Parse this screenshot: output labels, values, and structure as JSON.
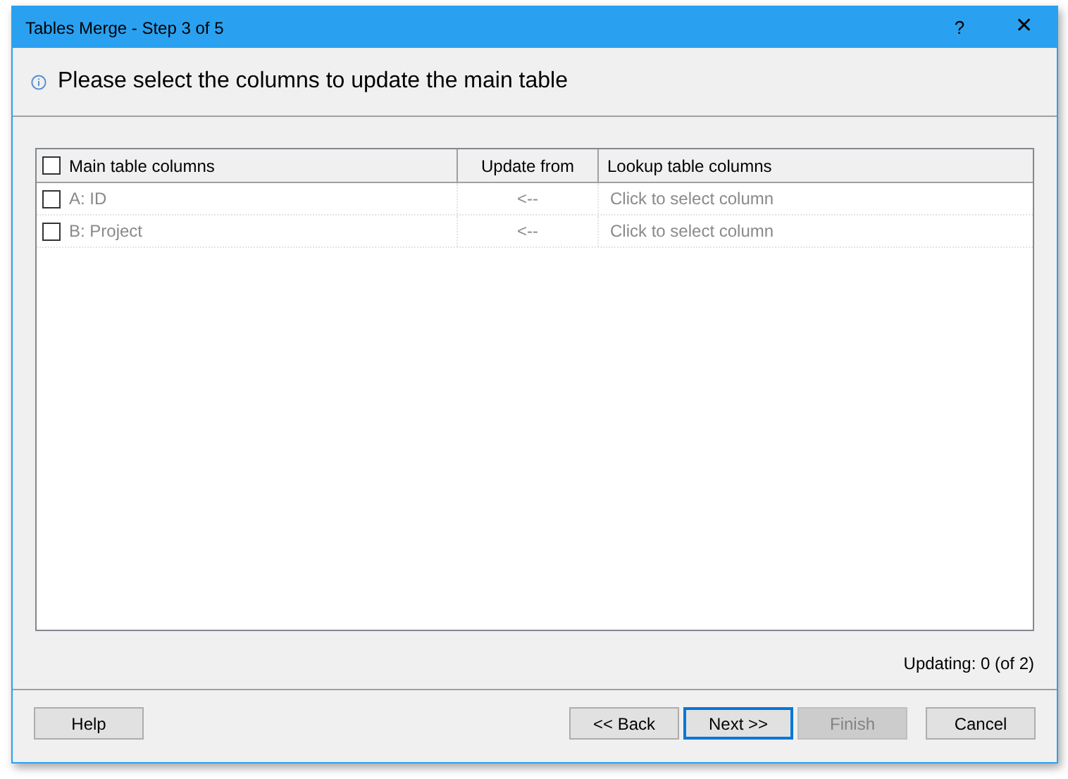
{
  "window": {
    "title": "Tables Merge - Step 3 of 5",
    "help_glyph": "?",
    "close_glyph": "✕"
  },
  "instruction": "Please select the columns to update the main table",
  "table": {
    "select_all_checked": false,
    "columns": [
      "Main table columns",
      "Update from",
      "Lookup table columns"
    ],
    "rows": [
      {
        "checked": false,
        "main": "A: ID",
        "arrow": "<--",
        "lookup": "Click to select column"
      },
      {
        "checked": false,
        "main": "B: Project",
        "arrow": "<--",
        "lookup": "Click to select column"
      }
    ]
  },
  "status": "Updating: 0 (of 2)",
  "buttons": [
    {
      "label": "Help",
      "disabled": false,
      "focused": false
    },
    {
      "label": "<< Back",
      "disabled": false,
      "focused": false
    },
    {
      "label": "Next >>",
      "disabled": false,
      "focused": true
    },
    {
      "label": "Finish",
      "disabled": true,
      "focused": false
    },
    {
      "label": "Cancel",
      "disabled": false,
      "focused": false
    }
  ]
}
